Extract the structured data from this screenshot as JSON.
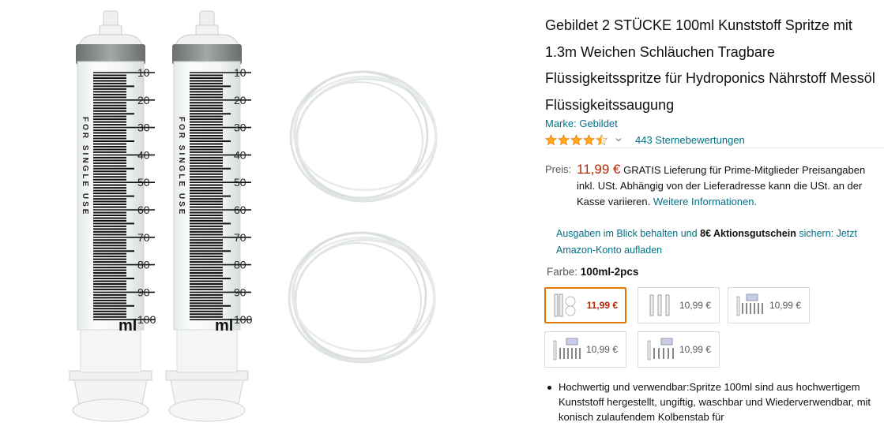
{
  "product": {
    "title": "Gebildet 2 STÜCKE 100ml Kunststoff Spritze mit 1.3m Weichen Schläuchen Tragbare Flüssigkeitsspritze für Hydroponics Nährstoff Messöl Flüssigkeitssaugung",
    "brand": "Marke: Gebildet",
    "rating_stars": 4.5,
    "rating_count": "443 Sternebewertungen"
  },
  "image": {
    "scale_numbers": [
      "10",
      "20",
      "30",
      "40",
      "50",
      "60",
      "70",
      "80",
      "90",
      "100"
    ],
    "unit": "ml",
    "side_text": "FOR SINGLE USE"
  },
  "price": {
    "label": "Preis:",
    "value": "11,99 €",
    "delivery": "GRATIS Lieferung für Prime-Mitglieder",
    "note": "Preisangaben inkl. USt. Abhängig von der Lieferadresse kann die USt. an der Kasse variieren.",
    "more_link": "Weitere Informationen."
  },
  "coupon": {
    "prefix": "Ausgaben im Blick behalten und",
    "bold": "8€ Aktionsgutschein",
    "suffix": "sichern: Jetzt Amazon-Konto aufladen"
  },
  "color": {
    "label": "Farbe:",
    "selected": "100ml-2pcs",
    "swatches": [
      {
        "price": "11,99 €",
        "selected": true
      },
      {
        "price": "10,99 €",
        "selected": false
      },
      {
        "price": "10,99 €",
        "selected": false
      },
      {
        "price": "10,99 €",
        "selected": false
      },
      {
        "price": "10,99 €",
        "selected": false
      }
    ]
  },
  "bullets": [
    "Hochwertig und verwendbar:Spritze 100ml sind aus hochwertigem Kunststoff hergestellt, ungiftig, waschbar und Wiederverwendbar, mit konisch zulaufendem Kolbenstab für"
  ],
  "colors": {
    "link": "#007185",
    "price": "#b12704",
    "selected_border": "#e77600",
    "star": "#ffa41c"
  }
}
